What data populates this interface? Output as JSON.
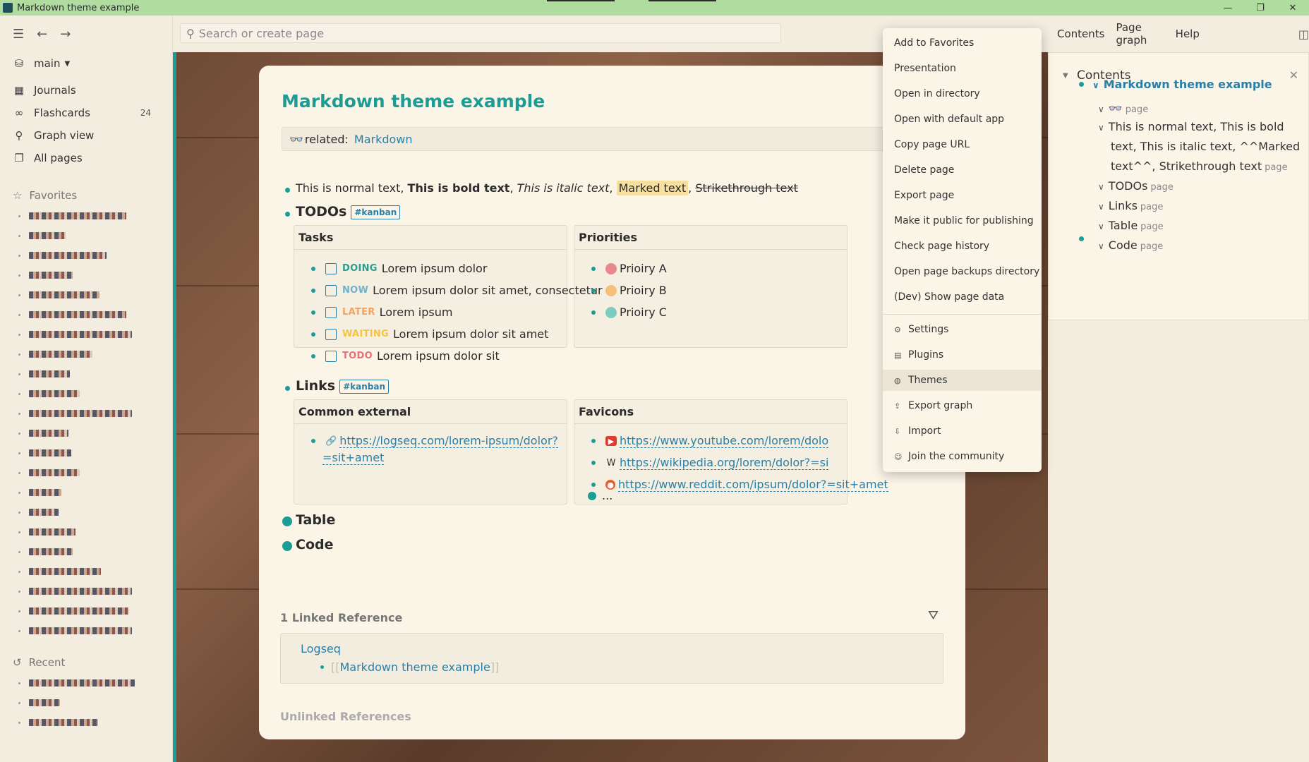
{
  "window": {
    "title": "Markdown theme example",
    "min": "—",
    "max": "❐",
    "close": "✕"
  },
  "header": {
    "search_placeholder": "Search or create page",
    "right_links": [
      "Contents",
      "Page graph",
      "Help"
    ]
  },
  "sidebar": {
    "graph_name": "main",
    "nav": [
      {
        "label": "Journals",
        "icon": "calendar-icon"
      },
      {
        "label": "Flashcards",
        "icon": "infinity-icon",
        "count": "24"
      },
      {
        "label": "Graph view",
        "icon": "graph-icon"
      },
      {
        "label": "All pages",
        "icon": "pages-icon"
      }
    ],
    "favorites_label": "Favorites",
    "recent_label": "Recent"
  },
  "page": {
    "title": "Markdown theme example",
    "property_key": "related:",
    "property_value": "Markdown",
    "text_line": {
      "normal": "This is normal text, ",
      "bold": "This is bold text",
      "sep1": ", ",
      "italic": "This is italic text",
      "sep2": ", ",
      "marked": "Marked text",
      "sep3": ", ",
      "strike": "Strikethrough text"
    },
    "todos": {
      "heading": "TODOs",
      "tag": "#kanban",
      "tasks_header": "Tasks",
      "tasks": [
        {
          "marker": "DOING",
          "color": "#2a9d8f",
          "text": "Lorem ipsum dolor"
        },
        {
          "marker": "NOW",
          "color": "#6fb1c8",
          "text": "Lorem ipsum dolor sit amet, consectetur"
        },
        {
          "marker": "LATER",
          "color": "#f4a261",
          "text": "Lorem ipsum"
        },
        {
          "marker": "WAITING",
          "color": "#f6c343",
          "text": "Lorem ipsum dolor sit amet"
        },
        {
          "marker": "TODO",
          "color": "#e76f7a",
          "text": "Lorem ipsum dolor sit"
        }
      ],
      "priorities_header": "Priorities",
      "priorities": [
        {
          "text": "Prioiry A",
          "color": "#e8888e"
        },
        {
          "text": "Prioiry B",
          "color": "#f5c07a"
        },
        {
          "text": "Prioiry C",
          "color": "#7ecbc1"
        }
      ]
    },
    "links": {
      "heading": "Links",
      "tag": "#kanban",
      "external_header": "Common external",
      "external_line1": "https://logseq.com/lorem-ipsum/dolor?",
      "external_line2": "=sit+amet",
      "favicons_header": "Favicons",
      "favicons": [
        {
          "icon": "youtube-icon",
          "text": "https://www.youtube.com/lorem/dolo"
        },
        {
          "icon": "wikipedia-icon",
          "text": "https://wikipedia.org/lorem/dolor?=si"
        },
        {
          "icon": "reddit-icon",
          "text": "https://www.reddit.com/ipsum/dolor?=sit+amet"
        }
      ],
      "ellipsis": "..."
    },
    "table_heading": "Table",
    "code_heading": "Code",
    "linked_refs_label": "1 Linked Reference",
    "linked_source": "Logseq",
    "linked_ref_open": "[[",
    "linked_ref_text": "Markdown theme example",
    "linked_ref_close": "]]",
    "unlinked_label": "Unlinked References"
  },
  "contents_panel": {
    "title": "Contents",
    "page_title": "Markdown theme example",
    "rows": [
      {
        "text": "",
        "icon": "glasses-icon",
        "suffix": "page"
      },
      {
        "text": "This is normal text, This is bold",
        "suffix": ""
      },
      {
        "text": "text, This is italic text, ^^Marked",
        "suffix": ""
      },
      {
        "text": "text^^, Strikethrough text",
        "suffix": "page"
      },
      {
        "text": "TODOs",
        "suffix": "page"
      },
      {
        "text": "Links",
        "suffix": "page"
      },
      {
        "text": "Table",
        "suffix": "page"
      },
      {
        "text": "Code",
        "suffix": "page"
      }
    ]
  },
  "menu": {
    "items": [
      "Add to Favorites",
      "Presentation",
      "Open in directory",
      "Open with default app",
      "Copy page URL",
      "Delete page",
      "Export page",
      "Make it public for publishing",
      "Check page history",
      "Open page backups directory",
      "(Dev) Show page data"
    ],
    "settings_items": [
      {
        "label": "Settings",
        "icon": "gear-icon"
      },
      {
        "label": "Plugins",
        "icon": "plugins-icon"
      },
      {
        "label": "Themes",
        "icon": "palette-icon"
      },
      {
        "label": "Export graph",
        "icon": "export-icon"
      },
      {
        "label": "Import",
        "icon": "import-icon"
      },
      {
        "label": "Join the community",
        "icon": "discord-icon"
      }
    ]
  },
  "colors": {
    "accent": "#1b9d95",
    "link": "#2b7fa6",
    "titlebar": "#b1dca0"
  }
}
